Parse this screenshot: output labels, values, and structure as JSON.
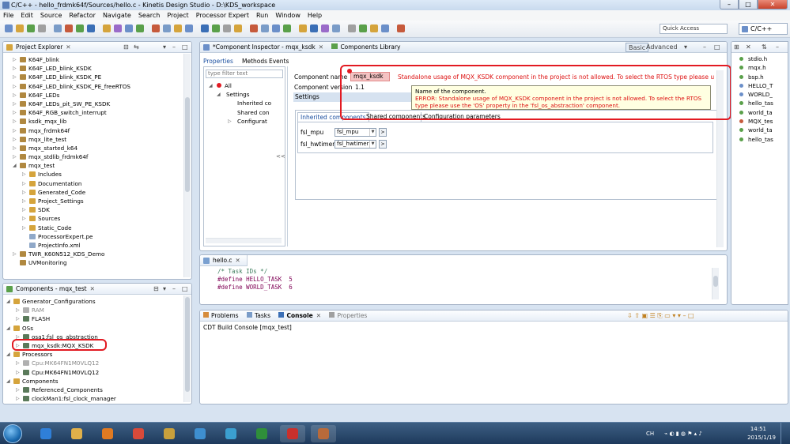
{
  "window": {
    "title": "C/C++ - hello_frdmk64f/Sources/hello.c - Kinetis Design Studio - D:\\KDS_workspace"
  },
  "menu": [
    "File",
    "Edit",
    "Source",
    "Refactor",
    "Navigate",
    "Search",
    "Project",
    "Processor Expert",
    "Run",
    "Window",
    "Help"
  ],
  "toolbar": {
    "quick_access_placeholder": "Quick Access",
    "perspective": "C/C++"
  },
  "project_explorer": {
    "title": "Project Explorer",
    "items": [
      {
        "label": "K64F_blink",
        "level": 1,
        "expanded": false
      },
      {
        "label": "K64F_LED_blink_KSDK",
        "level": 1,
        "expanded": false
      },
      {
        "label": "K64F_LED_blink_KSDK_PE",
        "level": 1,
        "expanded": false
      },
      {
        "label": "K64F_LED_blink_KSDK_PE_freeRTOS",
        "level": 1,
        "expanded": false
      },
      {
        "label": "K64F_LEDs",
        "level": 1,
        "expanded": false
      },
      {
        "label": "K64F_LEDs_pit_SW_PE_KSDK",
        "level": 1,
        "expanded": false
      },
      {
        "label": "K64F_RGB_switch_interrupt",
        "level": 1,
        "expanded": false
      },
      {
        "label": "ksdk_mqx_lib",
        "level": 1,
        "expanded": false
      },
      {
        "label": "mqx_frdmk64f",
        "level": 1,
        "expanded": false
      },
      {
        "label": "mqx_lite_test",
        "level": 1,
        "expanded": false
      },
      {
        "label": "mqx_started_k64",
        "level": 1,
        "expanded": false
      },
      {
        "label": "mqx_stdlib_frdmk64f",
        "level": 1,
        "expanded": false
      },
      {
        "label": "mqx_test",
        "level": 1,
        "expanded": true
      },
      {
        "label": "Includes",
        "level": 2,
        "expanded": false
      },
      {
        "label": "Documentation",
        "level": 2,
        "expanded": false
      },
      {
        "label": "Generated_Code",
        "level": 2,
        "expanded": false
      },
      {
        "label": "Project_Settings",
        "level": 2,
        "expanded": false
      },
      {
        "label": "SDK",
        "level": 2,
        "expanded": false
      },
      {
        "label": "Sources",
        "level": 2,
        "expanded": false
      },
      {
        "label": "Static_Code",
        "level": 2,
        "expanded": false
      },
      {
        "label": "ProcessorExpert.pe",
        "level": 2,
        "leaf": true
      },
      {
        "label": "ProjectInfo.xml",
        "level": 2,
        "leaf": true
      },
      {
        "label": "TWR_K60N512_KDS_Demo",
        "level": 1,
        "expanded": false
      },
      {
        "label": "UVMonitoring",
        "level": 1,
        "leaf": true
      }
    ]
  },
  "components_view": {
    "title": "Components - mqx_test",
    "items": [
      {
        "label": "Generator_Configurations",
        "level": 1,
        "expanded": true
      },
      {
        "label": "RAM",
        "level": 2,
        "gray": true
      },
      {
        "label": "FLASH",
        "level": 2
      },
      {
        "label": "OSs",
        "level": 1,
        "expanded": true
      },
      {
        "label": "osa1:fsl_os_abstraction",
        "level": 2
      },
      {
        "label": "mqx_ksdk:MQX_KSDK",
        "level": 2
      },
      {
        "label": "Processors",
        "level": 1,
        "expanded": true
      },
      {
        "label": "Cpu:MK64FN1M0VLQ12",
        "level": 2,
        "gray": true
      },
      {
        "label": "Cpu:MK64FN1M0VLQ12",
        "level": 2
      },
      {
        "label": "Components",
        "level": 1,
        "expanded": true
      },
      {
        "label": "Referenced_Components",
        "level": 2
      },
      {
        "label": "clockMan1:fsl_clock_manager",
        "level": 2
      }
    ]
  },
  "inspector": {
    "tab_title": "*Component Inspector - mqx_ksdk",
    "library_tab": "Components Library",
    "mode_basic": "Basic",
    "mode_advanced": "Advanced",
    "subtabs": [
      "Properties",
      "Methods",
      "Events"
    ],
    "filter_placeholder": "type filter text",
    "tree": [
      {
        "label": "All",
        "level": 1
      },
      {
        "label": "Settings",
        "level": 2
      },
      {
        "label": "Inherited co",
        "level": 3
      },
      {
        "label": "Shared con",
        "level": 3
      },
      {
        "label": "Configurat",
        "level": 3
      }
    ],
    "collapse_btn": "<<",
    "component_name_label": "Component name",
    "component_name_value": "mqx_ksdk",
    "component_version_label": "Component version",
    "component_version_value": "1.1",
    "settings_label": "Settings",
    "error_inline": "Standalone usage of MQX_KSDK component in the project is not allowed. To select the RTOS type please use the 'OS' ...",
    "tooltip_title": "Name of the component.",
    "tooltip_error": "ERROR: Standalone usage of MQX_KSDK component in the project is not allowed. To select the RTOS type please use the 'OS' property in the 'fsl_os_abstraction' component.",
    "settings_tabs": [
      "Inherited components",
      "Shared components",
      "Configuration parameters"
    ],
    "settings_rows": [
      {
        "label": "fsl_mpu",
        "value": "fsl_mpu"
      },
      {
        "label": "fsl_hwtimer",
        "value": "fsl_hwtimer"
      }
    ]
  },
  "editor": {
    "tab": "hello.c",
    "lines": [
      "/* Task IDs */",
      "#define HELLO_TASK  5",
      "#define WORLD_TASK  6"
    ]
  },
  "bottom": {
    "tabs": [
      "Problems",
      "Tasks",
      "Console",
      "Properties"
    ],
    "console_title": "CDT Build Console [mqx_test]"
  },
  "outline": {
    "items": [
      "stdio.h",
      "mqx.h",
      "bsp.h",
      "HELLO_T",
      "WORLD_",
      "hello_tas",
      "world_ta",
      "MQX_tes",
      "world_ta",
      "hello_tas"
    ]
  },
  "taskbar": {
    "ime": "CH",
    "time": "14:51",
    "date": "2015/1/19"
  },
  "colors": {
    "error": "#dd1111",
    "annotation": "#e21a22",
    "accent": "#3b6fb6"
  }
}
